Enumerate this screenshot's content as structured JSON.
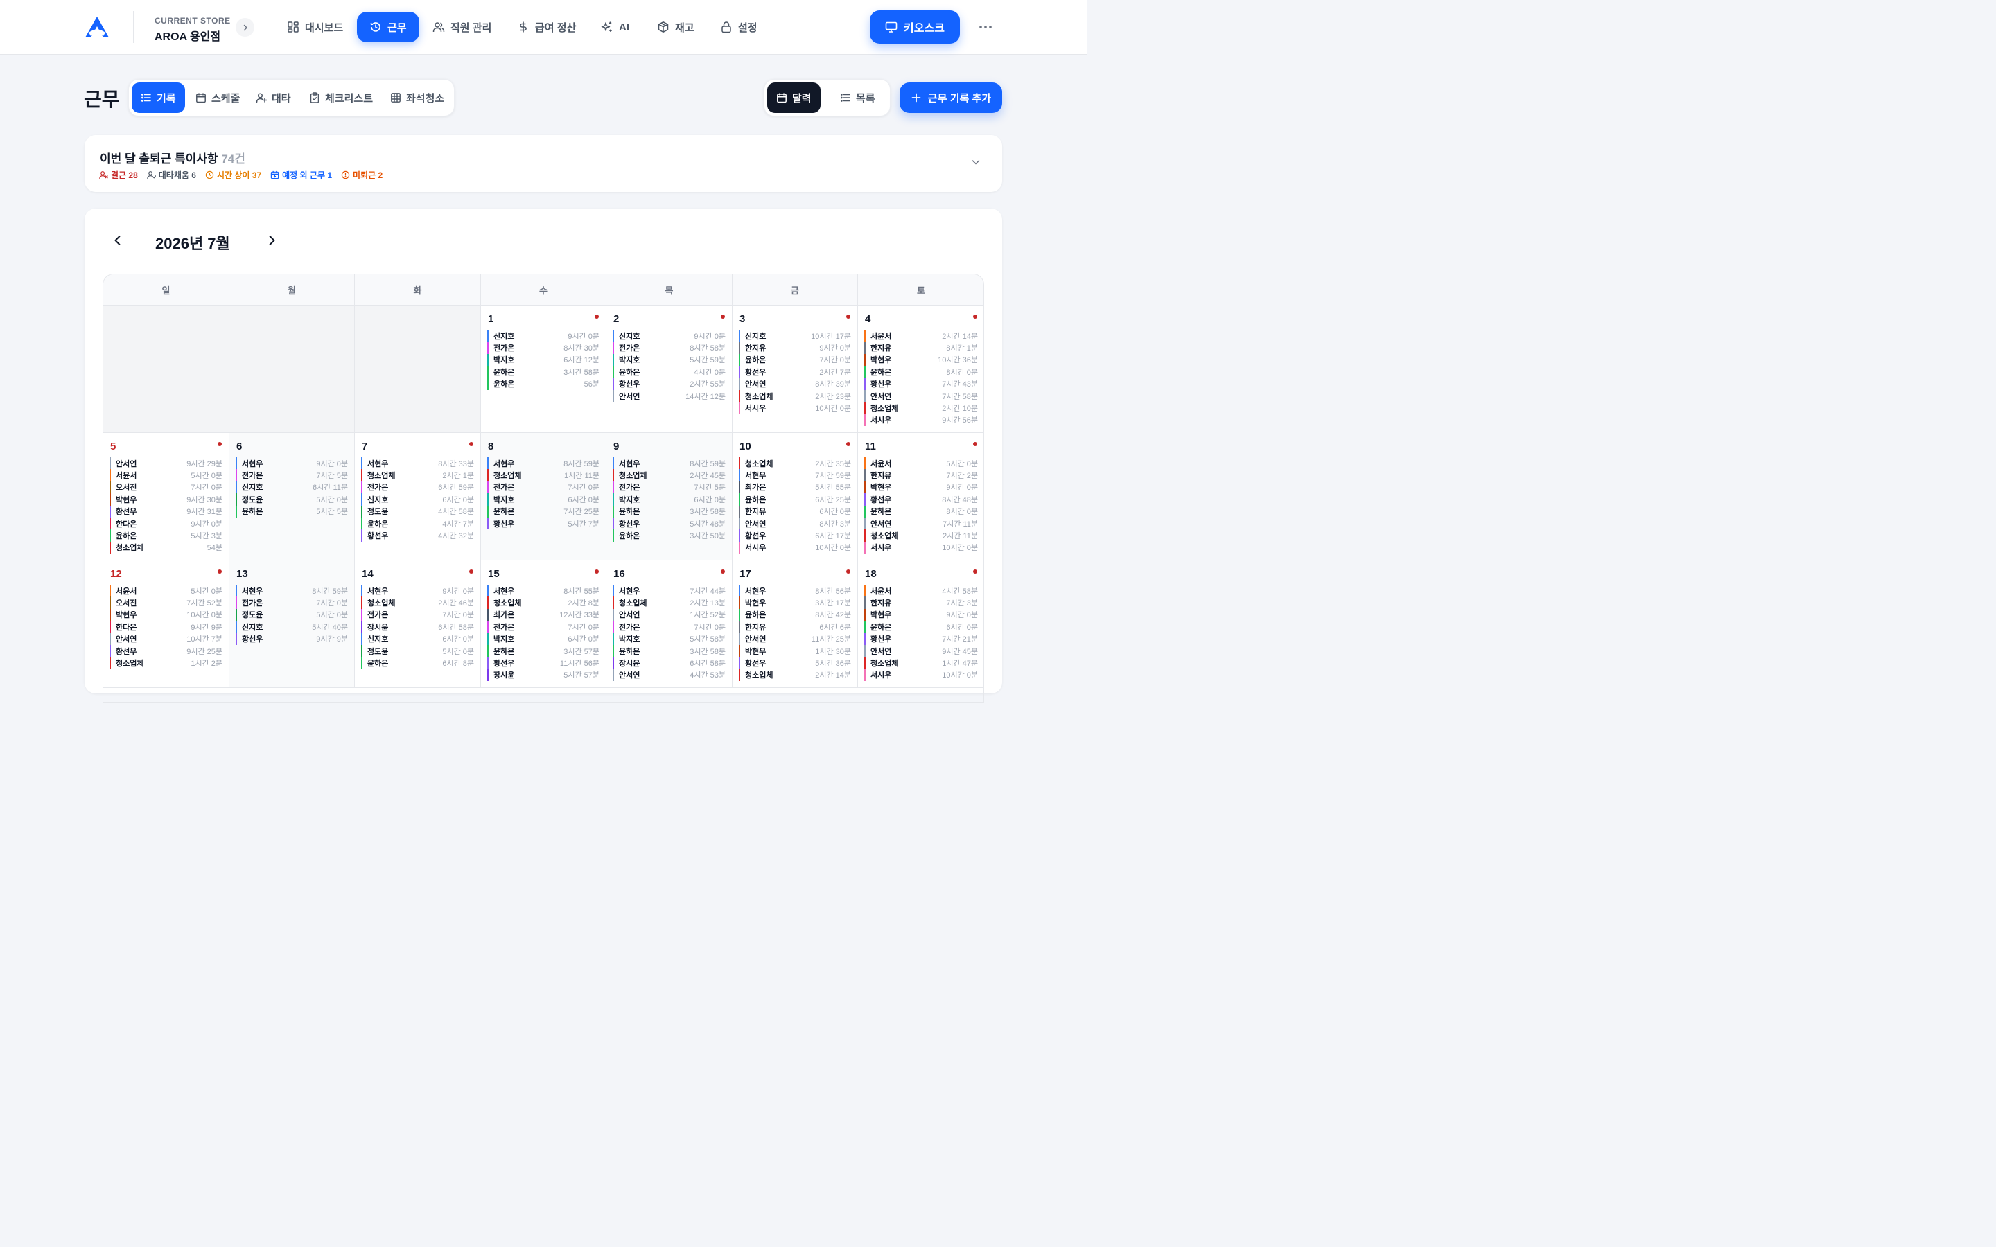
{
  "store": {
    "label": "CURRENT STORE",
    "name": "AROA 용인점"
  },
  "nav": [
    {
      "label": "대시보드",
      "icon": "dashboard-icon"
    },
    {
      "label": "근무",
      "icon": "clock-icon",
      "active": true
    },
    {
      "label": "직원 관리",
      "icon": "users-icon"
    },
    {
      "label": "급여 정산",
      "icon": "dollar-icon"
    },
    {
      "label": "AI",
      "icon": "sparkle-icon"
    },
    {
      "label": "재고",
      "icon": "box-icon"
    },
    {
      "label": "설정",
      "icon": "lock-icon"
    }
  ],
  "kiosk_label": "키오스크",
  "page_title": "근무",
  "subtabs": [
    "기록",
    "스케줄",
    "대타",
    "체크리스트",
    "좌석청소"
  ],
  "view_toggle": [
    "달력",
    "목록"
  ],
  "add_label": "근무 기록 추가",
  "notice": {
    "title": "이번 달 출퇴근 특이사항",
    "count": "74건",
    "stats": [
      {
        "label": "결근 28",
        "color": "#c62828",
        "icon": "user-x-icon"
      },
      {
        "label": "대타채움 6",
        "color": "#4b5563",
        "icon": "user-check-icon"
      },
      {
        "label": "시간 상이 37",
        "color": "#e67e00",
        "icon": "clock-alert-icon"
      },
      {
        "label": "예정 외 근무 1",
        "color": "#1463ff",
        "icon": "calendar-plus-icon"
      },
      {
        "label": "미퇴근 2",
        "color": "#e65100",
        "icon": "alert-circle-icon"
      }
    ]
  },
  "calendar": {
    "title": "2026년 7월",
    "weekdays": [
      "일",
      "월",
      "화",
      "수",
      "목",
      "금",
      "토"
    ],
    "colors": {
      "신지호": "#3b82f6",
      "전가은": "#d946ef",
      "박지호": "#14b8a6",
      "윤하은": "#22c55e",
      "황선우": "#8b5cf6",
      "안서연": "#94a3b8",
      "한지유": "#6b7280",
      "청소업체": "#dc2626",
      "서시우": "#f472b6",
      "서윤서": "#f97316",
      "박현우": "#c2410c",
      "서현우": "#3b82f6",
      "오서진": "#a16207",
      "한다은": "#e11d48",
      "정도윤": "#16a34a",
      "최가은": "#475569",
      "장시윤": "#7c3aed"
    },
    "weeks": [
      [
        null,
        null,
        null,
        {
          "day": "1",
          "dot": true,
          "entries": [
            [
              "신지호",
              "9시간 0분"
            ],
            [
              "전가은",
              "8시간 30분"
            ],
            [
              "박지호",
              "6시간 12분"
            ],
            [
              "윤하은",
              "3시간 58분"
            ],
            [
              "윤하은",
              "56분"
            ]
          ]
        },
        {
          "day": "2",
          "dot": true,
          "entries": [
            [
              "신지호",
              "9시간 0분"
            ],
            [
              "전가은",
              "8시간 58분"
            ],
            [
              "박지호",
              "5시간 59분"
            ],
            [
              "윤하은",
              "4시간 0분"
            ],
            [
              "황선우",
              "2시간 55분"
            ],
            [
              "안서연",
              "14시간 12분"
            ]
          ]
        },
        {
          "day": "3",
          "dot": true,
          "entries": [
            [
              "신지호",
              "10시간 17분"
            ],
            [
              "한지유",
              "9시간 0분"
            ],
            [
              "윤하은",
              "7시간 0분"
            ],
            [
              "황선우",
              "2시간 7분"
            ],
            [
              "안서연",
              "8시간 39분"
            ],
            [
              "청소업체",
              "2시간 23분"
            ],
            [
              "서시우",
              "10시간 0분"
            ]
          ]
        },
        {
          "day": "4",
          "dot": true,
          "entries": [
            [
              "서윤서",
              "2시간 14분"
            ],
            [
              "한지유",
              "8시간 1분"
            ],
            [
              "박현우",
              "10시간 36분"
            ],
            [
              "윤하은",
              "8시간 0분"
            ],
            [
              "황선우",
              "7시간 43분"
            ],
            [
              "안서연",
              "7시간 58분"
            ],
            [
              "청소업체",
              "2시간 10분"
            ],
            [
              "서시우",
              "9시간 56분"
            ]
          ]
        }
      ],
      [
        {
          "day": "5",
          "dot": true,
          "sun": true,
          "entries": [
            [
              "안서연",
              "9시간 29분"
            ],
            [
              "서윤서",
              "5시간 0분"
            ],
            [
              "오서진",
              "7시간 0분"
            ],
            [
              "박현우",
              "9시간 30분"
            ],
            [
              "황선우",
              "9시간 31분"
            ],
            [
              "한다은",
              "9시간 0분"
            ],
            [
              "윤하은",
              "5시간 3분"
            ],
            [
              "청소업체",
              "54분"
            ]
          ]
        },
        {
          "day": "6",
          "dot": false,
          "entries": [
            [
              "서현우",
              "9시간 0분"
            ],
            [
              "전가은",
              "7시간 5분"
            ],
            [
              "신지호",
              "6시간 11분"
            ],
            [
              "정도윤",
              "5시간 0분"
            ],
            [
              "윤하은",
              "5시간 5분"
            ]
          ]
        },
        {
          "day": "7",
          "dot": true,
          "entries": [
            [
              "서현우",
              "8시간 33분"
            ],
            [
              "청소업체",
              "2시간 1분"
            ],
            [
              "전가은",
              "6시간 59분"
            ],
            [
              "신지호",
              "6시간 0분"
            ],
            [
              "정도윤",
              "4시간 58분"
            ],
            [
              "윤하은",
              "4시간 7분"
            ],
            [
              "황선우",
              "4시간 32분"
            ]
          ]
        },
        {
          "day": "8",
          "dot": false,
          "entries": [
            [
              "서현우",
              "8시간 59분"
            ],
            [
              "청소업체",
              "1시간 11분"
            ],
            [
              "전가은",
              "7시간 0분"
            ],
            [
              "박지호",
              "6시간 0분"
            ],
            [
              "윤하은",
              "7시간 25분"
            ],
            [
              "황선우",
              "5시간 7분"
            ]
          ]
        },
        {
          "day": "9",
          "dot": false,
          "entries": [
            [
              "서현우",
              "8시간 59분"
            ],
            [
              "청소업체",
              "2시간 45분"
            ],
            [
              "전가은",
              "7시간 5분"
            ],
            [
              "박지호",
              "6시간 0분"
            ],
            [
              "윤하은",
              "3시간 58분"
            ],
            [
              "황선우",
              "5시간 48분"
            ],
            [
              "윤하은",
              "3시간 50분"
            ]
          ]
        },
        {
          "day": "10",
          "dot": true,
          "entries": [
            [
              "청소업체",
              "2시간 35분"
            ],
            [
              "서현우",
              "7시간 59분"
            ],
            [
              "최가은",
              "5시간 55분"
            ],
            [
              "윤하은",
              "6시간 25분"
            ],
            [
              "한지유",
              "6시간 0분"
            ],
            [
              "안서연",
              "8시간 3분"
            ],
            [
              "황선우",
              "6시간 17분"
            ],
            [
              "서시우",
              "10시간 0분"
            ]
          ]
        },
        {
          "day": "11",
          "dot": true,
          "entries": [
            [
              "서윤서",
              "5시간 0분"
            ],
            [
              "한지유",
              "7시간 2분"
            ],
            [
              "박현우",
              "9시간 0분"
            ],
            [
              "황선우",
              "8시간 48분"
            ],
            [
              "윤하은",
              "8시간 0분"
            ],
            [
              "안서연",
              "7시간 11분"
            ],
            [
              "청소업체",
              "2시간 11분"
            ],
            [
              "서시우",
              "10시간 0분"
            ]
          ]
        }
      ],
      [
        {
          "day": "12",
          "dot": true,
          "sun": true,
          "entries": [
            [
              "서윤서",
              "5시간 0분"
            ],
            [
              "오서진",
              "7시간 52분"
            ],
            [
              "박현우",
              "10시간 0분"
            ],
            [
              "한다은",
              "9시간 9분"
            ],
            [
              "안서연",
              "10시간 7분"
            ],
            [
              "황선우",
              "9시간 25분"
            ],
            [
              "청소업체",
              "1시간 2분"
            ]
          ]
        },
        {
          "day": "13",
          "dot": false,
          "entries": [
            [
              "서현우",
              "8시간 59분"
            ],
            [
              "전가은",
              "7시간 0분"
            ],
            [
              "정도윤",
              "5시간 0분"
            ],
            [
              "신지호",
              "5시간 40분"
            ],
            [
              "황선우",
              "9시간 9분"
            ]
          ]
        },
        {
          "day": "14",
          "dot": true,
          "entries": [
            [
              "서현우",
              "9시간 0분"
            ],
            [
              "청소업체",
              "2시간 46분"
            ],
            [
              "전가은",
              "7시간 0분"
            ],
            [
              "장시윤",
              "6시간 58분"
            ],
            [
              "신지호",
              "6시간 0분"
            ],
            [
              "정도윤",
              "5시간 0분"
            ],
            [
              "윤하은",
              "6시간 8분"
            ]
          ]
        },
        {
          "day": "15",
          "dot": true,
          "entries": [
            [
              "서현우",
              "8시간 55분"
            ],
            [
              "청소업체",
              "2시간 8분"
            ],
            [
              "최가은",
              "12시간 33분"
            ],
            [
              "전가은",
              "7시간 0분"
            ],
            [
              "박지호",
              "6시간 0분"
            ],
            [
              "윤하은",
              "3시간 57분"
            ],
            [
              "황선우",
              "11시간 56분"
            ],
            [
              "장시윤",
              "5시간 57분"
            ]
          ]
        },
        {
          "day": "16",
          "dot": true,
          "entries": [
            [
              "서현우",
              "7시간 44분"
            ],
            [
              "청소업체",
              "2시간 13분"
            ],
            [
              "안서연",
              "1시간 52분"
            ],
            [
              "전가은",
              "7시간 0분"
            ],
            [
              "박지호",
              "5시간 58분"
            ],
            [
              "윤하은",
              "3시간 58분"
            ],
            [
              "장시윤",
              "6시간 58분"
            ],
            [
              "안서연",
              "4시간 53분"
            ]
          ]
        },
        {
          "day": "17",
          "dot": true,
          "entries": [
            [
              "서현우",
              "8시간 56분"
            ],
            [
              "박현우",
              "3시간 17분"
            ],
            [
              "윤하은",
              "8시간 42분"
            ],
            [
              "한지유",
              "6시간 6분"
            ],
            [
              "안서연",
              "11시간 25분"
            ],
            [
              "박현우",
              "1시간 30분"
            ],
            [
              "황선우",
              "5시간 36분"
            ],
            [
              "청소업체",
              "2시간 14분"
            ]
          ]
        },
        {
          "day": "18",
          "dot": true,
          "entries": [
            [
              "서윤서",
              "4시간 58분"
            ],
            [
              "한지유",
              "7시간 3분"
            ],
            [
              "박현우",
              "9시간 0분"
            ],
            [
              "윤하은",
              "6시간 0분"
            ],
            [
              "황선우",
              "7시간 21분"
            ],
            [
              "안서연",
              "9시간 45분"
            ],
            [
              "청소업체",
              "1시간 47분"
            ],
            [
              "서시우",
              "10시간 0분"
            ]
          ]
        }
      ]
    ]
  }
}
